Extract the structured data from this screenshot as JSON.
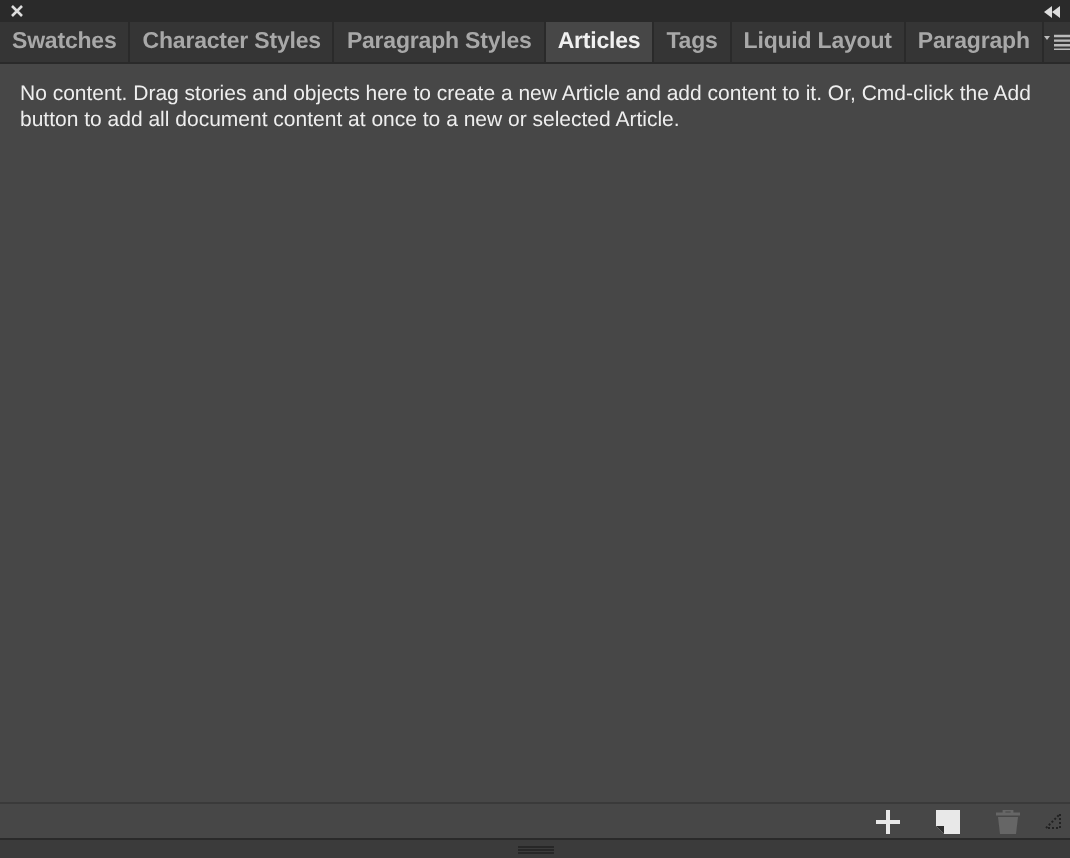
{
  "tabs": [
    {
      "label": "Swatches",
      "selected": false
    },
    {
      "label": "Character Styles",
      "selected": false
    },
    {
      "label": "Paragraph Styles",
      "selected": false
    },
    {
      "label": "Articles",
      "selected": true
    },
    {
      "label": "Tags",
      "selected": false
    },
    {
      "label": "Liquid Layout",
      "selected": false
    },
    {
      "label": "Paragraph",
      "selected": false
    }
  ],
  "message": "No content. Drag stories and objects here to create a new Article and add content to it. Or, Cmd-click the Add button to add all document content at once to a new or selected Article.",
  "footer_buttons": [
    {
      "kind": "add",
      "disabled": false
    },
    {
      "kind": "new",
      "disabled": false
    },
    {
      "kind": "delete",
      "disabled": true
    }
  ]
}
